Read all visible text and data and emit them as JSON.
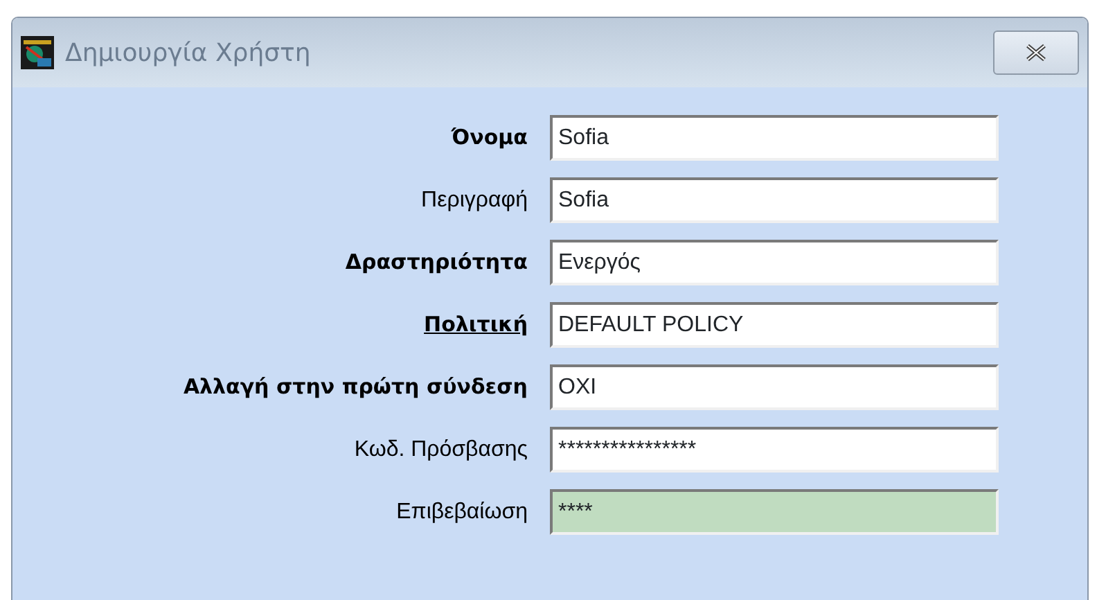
{
  "window": {
    "title": "Δημιουργία Χρήστη"
  },
  "fields": [
    {
      "label": "Όνομα",
      "value": "Sofia",
      "bold": true,
      "link": false,
      "highlighted": false
    },
    {
      "label": "Περιγραφή",
      "value": "Sofia",
      "bold": false,
      "link": false,
      "highlighted": false
    },
    {
      "label": "Δραστηριότητα",
      "value": "Ενεργός",
      "bold": true,
      "link": false,
      "highlighted": false
    },
    {
      "label": "Πολιτική",
      "value": "DEFAULT POLICY",
      "bold": true,
      "link": true,
      "highlighted": false
    },
    {
      "label": "Αλλαγή στην πρώτη σύνδεση",
      "value": "ΟΧΙ",
      "bold": true,
      "link": false,
      "highlighted": false
    },
    {
      "label": "Κωδ. Πρόσβασης",
      "value": "****************",
      "bold": false,
      "link": false,
      "highlighted": false
    },
    {
      "label": "Επιβεβαίωση",
      "value": "****",
      "bold": false,
      "link": false,
      "highlighted": true
    }
  ]
}
